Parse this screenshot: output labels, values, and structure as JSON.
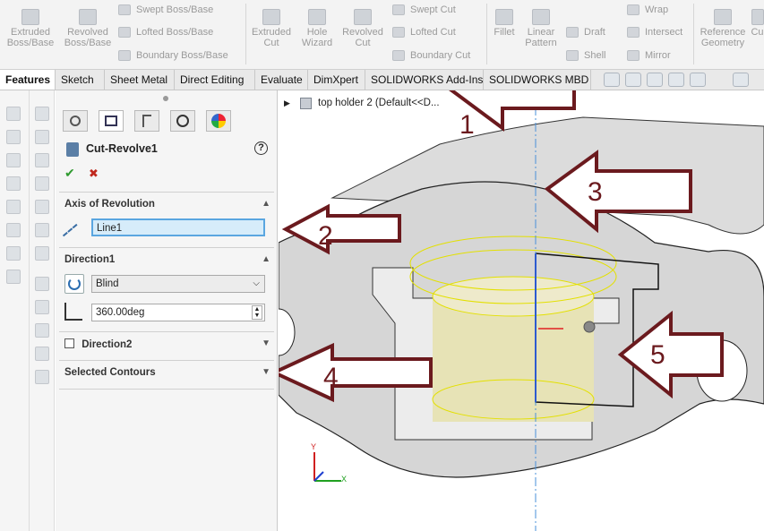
{
  "ribbon": {
    "extruded_boss": "Extruded Boss/Base",
    "revolved_boss": "Revolved Boss/Base",
    "swept_boss": "Swept Boss/Base",
    "lofted_boss": "Lofted Boss/Base",
    "boundary_boss": "Boundary Boss/Base",
    "extruded_cut": "Extruded Cut",
    "hole_wizard": "Hole Wizard",
    "revolved_cut": "Revolved Cut",
    "swept_cut": "Swept Cut",
    "lofted_cut": "Lofted Cut",
    "boundary_cut": "Boundary Cut",
    "fillet": "Fillet",
    "linear_pattern": "Linear Pattern",
    "draft": "Draft",
    "shell": "Shell",
    "wrap": "Wrap",
    "intersect": "Intersect",
    "mirror": "Mirror",
    "reference_geometry": "Reference Geometry",
    "curves_partial": "Cu"
  },
  "tabs": [
    "Features",
    "Sketch",
    "Sheet Metal",
    "Direct Editing",
    "Evaluate",
    "DimXpert",
    "SOLIDWORKS Add-Ins",
    "SOLIDWORKS MBD"
  ],
  "tree": {
    "label": "top holder 2  (Default<<D..."
  },
  "pm": {
    "title": "Cut-Revolve1",
    "help": "?",
    "ok": "✔",
    "cancel": "✖",
    "axis_header": "Axis of Revolution",
    "axis_value": "Line1",
    "dir1_header": "Direction1",
    "dir1_type": "Blind",
    "dir1_angle": "360.00deg",
    "dir2_header": "Direction2",
    "contours_header": "Selected Contours"
  },
  "annotations": [
    "1",
    "2",
    "3",
    "4",
    "5"
  ],
  "triad": {
    "x": "X",
    "y": "Y"
  },
  "colors": {
    "annotation_arrow": "#6b1a1e",
    "axis_field_highlight": "#d6ecfa",
    "preview_yellow": "#f0eca8"
  }
}
